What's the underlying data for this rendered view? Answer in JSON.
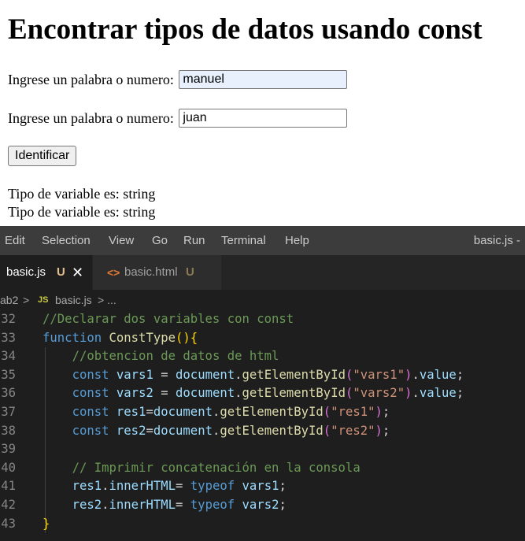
{
  "page": {
    "title": "Encontrar tipos de datos usando const",
    "field1": {
      "label": "Ingrese un palabra o numero:",
      "value": "manuel"
    },
    "field2": {
      "label": "Ingrese un palabra o numero:",
      "value": "juan"
    },
    "button_label": "Identificar",
    "result1": "Tipo de variable es: string",
    "result2": "Tipo de variable es: string"
  },
  "vscode": {
    "menu": [
      "Edit",
      "Selection",
      "View",
      "Go",
      "Run",
      "Terminal",
      "Help"
    ],
    "window_title": "basic.js -",
    "tabs": [
      {
        "name": "basic.js",
        "status": "U",
        "close": "✕",
        "active": true
      },
      {
        "name": "basic.html",
        "status": "U",
        "icon": "<>",
        "active": false
      }
    ],
    "breadcrumb": {
      "folder": "ab2",
      "sep": ">",
      "file_icon": "JS",
      "file": "basic.js",
      "more": "> ..."
    },
    "colors": {
      "comment": "#6a9955",
      "keyword": "#569cd6",
      "function": "#dcdcaa",
      "variable": "#9cdcfe",
      "string": "#ce9178"
    },
    "lines": [
      {
        "num": "32",
        "tokens": [
          {
            "t": "//Declarar dos variables con const",
            "c": "com"
          }
        ]
      },
      {
        "num": "33",
        "tokens": [
          {
            "t": "function",
            "c": "kw"
          },
          {
            "t": " ",
            "c": "pun"
          },
          {
            "t": "ConstType",
            "c": "fn"
          },
          {
            "t": "()",
            "c": "br1"
          },
          {
            "t": "{",
            "c": "br1"
          }
        ]
      },
      {
        "num": "34",
        "tokens": [
          {
            "t": "    ",
            "c": "pun"
          },
          {
            "t": "//obtencion de datos de html",
            "c": "com"
          }
        ]
      },
      {
        "num": "35",
        "tokens": [
          {
            "t": "    ",
            "c": "pun"
          },
          {
            "t": "const",
            "c": "kw"
          },
          {
            "t": " ",
            "c": "pun"
          },
          {
            "t": "vars1",
            "c": "var"
          },
          {
            "t": " = ",
            "c": "pun"
          },
          {
            "t": "document",
            "c": "var"
          },
          {
            "t": ".",
            "c": "pun"
          },
          {
            "t": "getElementById",
            "c": "fn"
          },
          {
            "t": "(",
            "c": "br2"
          },
          {
            "t": "\"vars1\"",
            "c": "str"
          },
          {
            "t": ")",
            "c": "br2"
          },
          {
            "t": ".",
            "c": "pun"
          },
          {
            "t": "value",
            "c": "var"
          },
          {
            "t": ";",
            "c": "pun"
          }
        ]
      },
      {
        "num": "36",
        "tokens": [
          {
            "t": "    ",
            "c": "pun"
          },
          {
            "t": "const",
            "c": "kw"
          },
          {
            "t": " ",
            "c": "pun"
          },
          {
            "t": "vars2",
            "c": "var"
          },
          {
            "t": " = ",
            "c": "pun"
          },
          {
            "t": "document",
            "c": "var"
          },
          {
            "t": ".",
            "c": "pun"
          },
          {
            "t": "getElementById",
            "c": "fn"
          },
          {
            "t": "(",
            "c": "br2"
          },
          {
            "t": "\"vars2\"",
            "c": "str"
          },
          {
            "t": ")",
            "c": "br2"
          },
          {
            "t": ".",
            "c": "pun"
          },
          {
            "t": "value",
            "c": "var"
          },
          {
            "t": ";",
            "c": "pun"
          }
        ]
      },
      {
        "num": "37",
        "tokens": [
          {
            "t": "    ",
            "c": "pun"
          },
          {
            "t": "const",
            "c": "kw"
          },
          {
            "t": " ",
            "c": "pun"
          },
          {
            "t": "res1",
            "c": "var"
          },
          {
            "t": "=",
            "c": "pun"
          },
          {
            "t": "document",
            "c": "var"
          },
          {
            "t": ".",
            "c": "pun"
          },
          {
            "t": "getElementById",
            "c": "fn"
          },
          {
            "t": "(",
            "c": "br2"
          },
          {
            "t": "\"res1\"",
            "c": "str"
          },
          {
            "t": ")",
            "c": "br2"
          },
          {
            "t": ";",
            "c": "pun"
          }
        ]
      },
      {
        "num": "38",
        "tokens": [
          {
            "t": "    ",
            "c": "pun"
          },
          {
            "t": "const",
            "c": "kw"
          },
          {
            "t": " ",
            "c": "pun"
          },
          {
            "t": "res2",
            "c": "var"
          },
          {
            "t": "=",
            "c": "pun"
          },
          {
            "t": "document",
            "c": "var"
          },
          {
            "t": ".",
            "c": "pun"
          },
          {
            "t": "getElementById",
            "c": "fn"
          },
          {
            "t": "(",
            "c": "br2"
          },
          {
            "t": "\"res2\"",
            "c": "str"
          },
          {
            "t": ")",
            "c": "br2"
          },
          {
            "t": ";",
            "c": "pun"
          }
        ]
      },
      {
        "num": "39",
        "tokens": []
      },
      {
        "num": "40",
        "tokens": [
          {
            "t": "    ",
            "c": "pun"
          },
          {
            "t": "// Imprimir concatenación en la consola",
            "c": "com"
          }
        ]
      },
      {
        "num": "41",
        "tokens": [
          {
            "t": "    ",
            "c": "pun"
          },
          {
            "t": "res1",
            "c": "var"
          },
          {
            "t": ".",
            "c": "pun"
          },
          {
            "t": "innerHTML",
            "c": "var"
          },
          {
            "t": "= ",
            "c": "pun"
          },
          {
            "t": "typeof",
            "c": "kw"
          },
          {
            "t": " ",
            "c": "pun"
          },
          {
            "t": "vars1",
            "c": "var"
          },
          {
            "t": ";",
            "c": "pun"
          }
        ]
      },
      {
        "num": "42",
        "tokens": [
          {
            "t": "    ",
            "c": "pun"
          },
          {
            "t": "res2",
            "c": "var"
          },
          {
            "t": ".",
            "c": "pun"
          },
          {
            "t": "innerHTML",
            "c": "var"
          },
          {
            "t": "= ",
            "c": "pun"
          },
          {
            "t": "typeof",
            "c": "kw"
          },
          {
            "t": " ",
            "c": "pun"
          },
          {
            "t": "vars2",
            "c": "var"
          },
          {
            "t": ";",
            "c": "pun"
          }
        ]
      },
      {
        "num": "43",
        "tokens": [
          {
            "t": "}",
            "c": "br1"
          }
        ]
      }
    ]
  }
}
